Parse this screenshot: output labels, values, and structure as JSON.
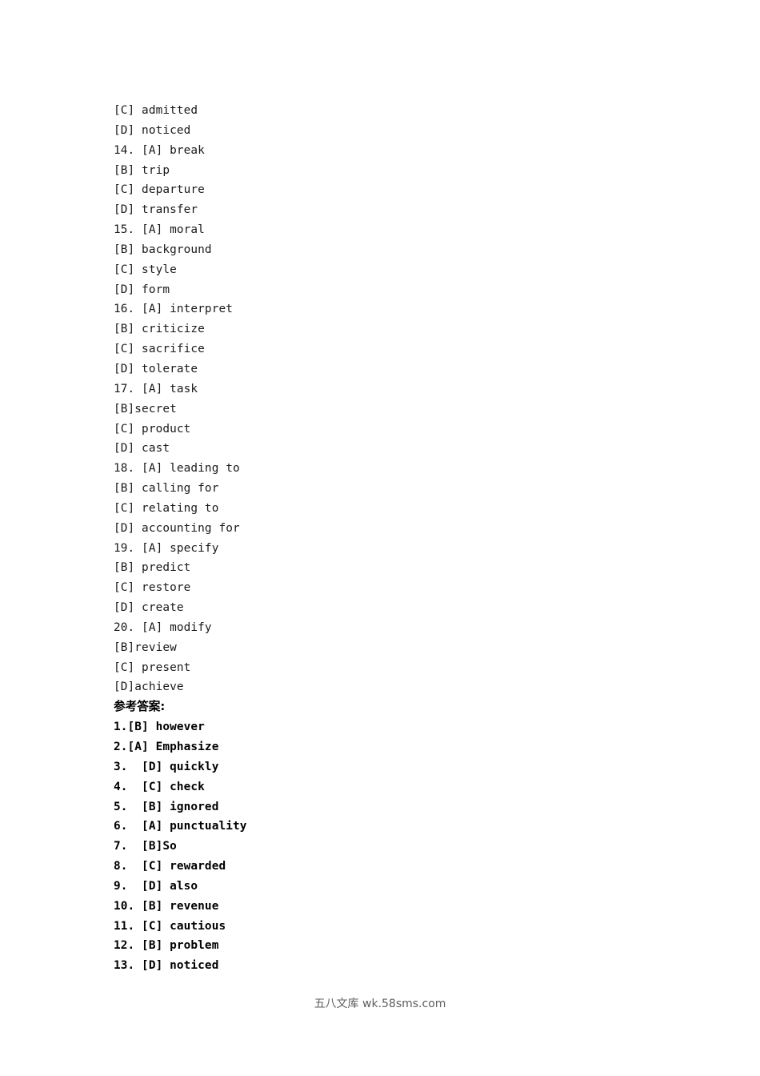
{
  "document": {
    "background_color": "#ffffff",
    "text_color": "#1a1a1a",
    "heading_color": "#000000",
    "watermark_color": "#5e5e5e",
    "options_lines": [
      "[C] admitted",
      "[D] noticed",
      "14. [A] break",
      "[B] trip",
      "[C] departure",
      "[D] transfer",
      "15. [A] moral",
      "[B] background",
      "[C] style",
      "[D] form",
      "16. [A] interpret",
      "[B] criticize",
      "[C] sacrifice",
      "[D] tolerate",
      "17. [A] task",
      "[B]secret",
      "[C] product",
      "[D] cast",
      "18. [A] leading to",
      "[B] calling for",
      "[C] relating to",
      "[D] accounting for",
      "19. [A] specify",
      "[B] predict",
      "[C] restore",
      "[D] create",
      "20. [A] modify",
      "[B]review",
      "[C] present",
      "[D]achieve"
    ],
    "answers_heading": "参考答案:",
    "answers_lines": [
      "1.[B] however",
      "2.[A] Emphasize",
      "3.  [D] quickly",
      "4.  [C] check",
      "5.  [B] ignored",
      "6.  [A] punctuality",
      "7.  [B]So",
      "8.  [C] rewarded",
      "9.  [D] also",
      "10. [B] revenue",
      "11. [C] cautious",
      "12. [B] problem",
      "13. [D] noticed"
    ],
    "watermark": "五八文库 wk.58sms.com"
  }
}
